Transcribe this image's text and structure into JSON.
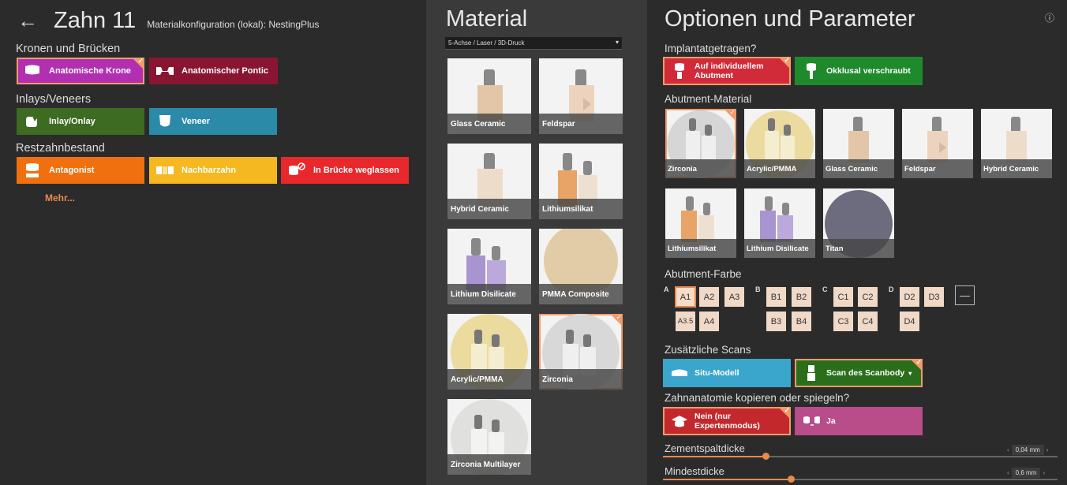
{
  "header": {
    "back_icon": "arrow-left-icon",
    "title": "Zahn 11",
    "material_config": "Materialkonfiguration (lokal): NestingPlus"
  },
  "sections": {
    "crowns": "Kronen und Brücken",
    "inlays": "Inlays/Veneers",
    "remaining": "Restzahnbestand"
  },
  "tooth_types": {
    "anatomic_crown": {
      "label": "Anatomische Krone",
      "color": "#b12fb0",
      "selected": true
    },
    "anatomic_pontic": {
      "label": "Anatomischer Pontic",
      "color": "#8a1530"
    },
    "inlay_onlay": {
      "label": "Inlay/Onlay",
      "color": "#3d6b22"
    },
    "veneer": {
      "label": "Veneer",
      "color": "#2b8aa7"
    },
    "antagonist": {
      "label": "Antagonist",
      "color": "#f07010"
    },
    "neighbor": {
      "label": "Nachbarzahn",
      "color": "#f5b820"
    },
    "omit_bridge": {
      "label": "In Brücke weglassen",
      "color": "#e8282a"
    }
  },
  "more_link": "Mehr...",
  "material": {
    "title": "Material",
    "dropdown_value": "5-Achse / Laser / 3D-Druck",
    "items": [
      {
        "label": "Glass Ceramic"
      },
      {
        "label": "Feldspar"
      },
      {
        "label": "Hybrid Ceramic"
      },
      {
        "label": "Lithiumsilikat"
      },
      {
        "label": "Lithium Disilicate"
      },
      {
        "label": "PMMA Composite"
      },
      {
        "label": "Acrylic/PMMA"
      },
      {
        "label": "Zirconia",
        "selected": true
      },
      {
        "label": "Zirconia Multilayer"
      }
    ]
  },
  "options": {
    "title": "Optionen und Parameter",
    "help_icon": "help-circle-icon",
    "implant_label": "Implantatgetragen?",
    "implant_individual": "Auf individuellem Abutment",
    "implant_screwed": "Okklusal verschraubt",
    "abutment_material_label": "Abutment-Material",
    "abutment_materials": [
      {
        "label": "Zirconia",
        "selected": true
      },
      {
        "label": "Acrylic/PMMA"
      },
      {
        "label": "Glass Ceramic"
      },
      {
        "label": "Feldspar"
      },
      {
        "label": "Hybrid Ceramic"
      },
      {
        "label": "Lithiumsilikat"
      },
      {
        "label": "Lithium Disilicate"
      },
      {
        "label": "Titan"
      }
    ],
    "abutment_color_label": "Abutment-Farbe",
    "shade_groups": {
      "a": "A",
      "b": "B",
      "c": "C",
      "d": "D"
    },
    "shades": {
      "a1": "A1",
      "a2": "A2",
      "a3": "A3",
      "a35": "A3.5",
      "a4": "A4",
      "b1": "B1",
      "b2": "B2",
      "b3": "B3",
      "b4": "B4",
      "c1": "C1",
      "c2": "C2",
      "c3": "C3",
      "c4": "C4",
      "d2": "D2",
      "d3": "D3",
      "d4": "D4"
    },
    "shade_none": "—",
    "additional_scans_label": "Zusätzliche Scans",
    "situ_model": "Situ-Modell",
    "scanbody": "Scan des Scanbody",
    "copy_label": "Zahnanatomie kopieren oder spiegeln?",
    "copy_no": "Nein (nur Expertenmodus)",
    "copy_yes": "Ja",
    "cement_label": "Zementspaltdicke",
    "cement_value": "0,04 mm",
    "min_thickness_label": "Mindestdicke",
    "min_thickness_value": "0,6 mm"
  }
}
